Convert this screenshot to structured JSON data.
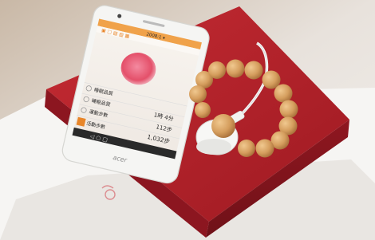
{
  "scene": {
    "description_free": true,
    "phone": {
      "brand": "acer",
      "status_title": "2008:1 ▾",
      "rows": [
        {
          "label": "睡眠品質",
          "value": ""
        },
        {
          "label": "睡眠品質",
          "value": "1時 4分"
        },
        {
          "label": "運動步數",
          "value": "112步"
        },
        {
          "label": "活動步數",
          "value": "1,032步"
        }
      ]
    }
  },
  "colors": {
    "box_red": "#b32029",
    "phone_white": "#f4f4f2",
    "bead_wood": "#d9a262",
    "blob_pink": "#e8566a",
    "accent_orange": "#e8862a"
  }
}
